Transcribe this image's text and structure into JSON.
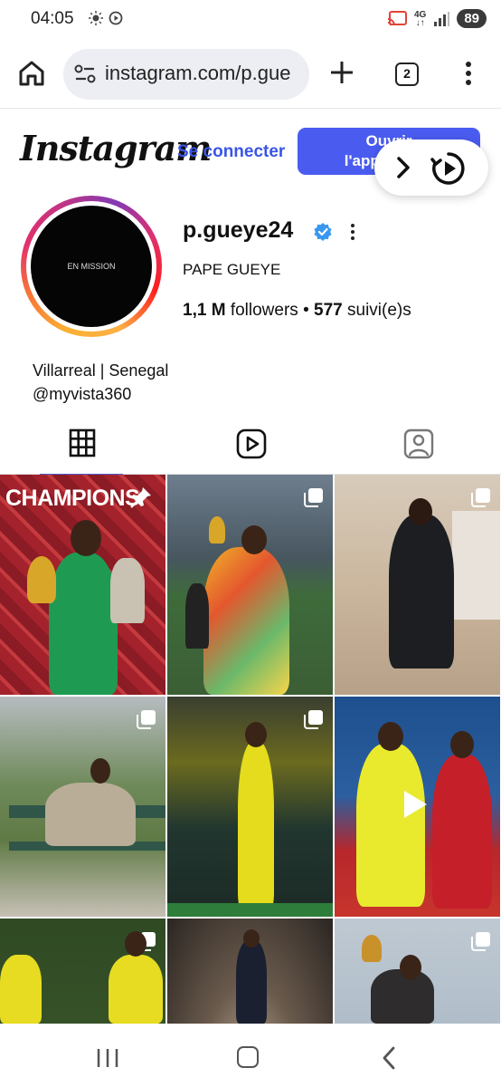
{
  "status_bar": {
    "time": "04:05",
    "network": "4G",
    "battery": "89"
  },
  "browser": {
    "url": "instagram.com/p.gue",
    "tab_count": "2"
  },
  "header": {
    "logo": "Instagram",
    "connect_label": "Se connecter",
    "open_app_label_line1": "Ouvrir",
    "open_app_label_line2": "l'application"
  },
  "profile": {
    "avatar_text": "EN MISSION",
    "username": "p.gueye24",
    "full_name": "PAPE GUEYE",
    "followers_count": "1,1 M",
    "followers_label": "followers",
    "separator": "•",
    "following_count": "577",
    "following_label": "suivi(e)s",
    "bio_line1": "Villarreal | Senegal",
    "bio_line2": "@myvista360"
  },
  "tabs": [
    {
      "icon": "grid-icon",
      "active": true
    },
    {
      "icon": "reels-icon",
      "active": false
    },
    {
      "icon": "tagged-icon",
      "active": false
    }
  ],
  "posts": [
    {
      "caption": "CHAMPIONS",
      "badge": "pin-icon"
    },
    {
      "caption": "",
      "badge": "multi-post-icon"
    },
    {
      "caption": "",
      "badge": "multi-post-icon"
    },
    {
      "caption": "",
      "badge": "multi-post-icon"
    },
    {
      "caption": "",
      "badge": "multi-post-icon"
    },
    {
      "caption": "",
      "badge": "play-icon"
    },
    {
      "caption": "",
      "badge": "multi-post-icon"
    },
    {
      "caption": "",
      "badge": ""
    },
    {
      "caption": "",
      "badge": "multi-post-icon"
    }
  ],
  "colors": {
    "accent_blue": "#4a5cf0",
    "link_blue": "#3a55e6",
    "villarreal_yellow": "#f2e21b"
  }
}
